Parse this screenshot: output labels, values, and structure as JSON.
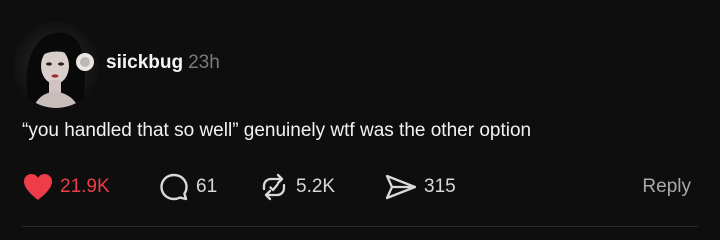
{
  "post": {
    "username": "siickbug",
    "timestamp": "23h",
    "text": "“you handled that so well” genuinely wtf was the other option"
  },
  "actions": {
    "likes": "21.9K",
    "comments": "61",
    "reposts": "5.2K",
    "shares": "315",
    "reply_label": "Reply",
    "liked": true
  },
  "colors": {
    "background": "#0e0e0e",
    "like_accent": "#ee3d48",
    "muted_text": "#7b7b7b"
  },
  "icons": [
    "heart-icon",
    "comment-icon",
    "repost-icon",
    "share-icon"
  ]
}
